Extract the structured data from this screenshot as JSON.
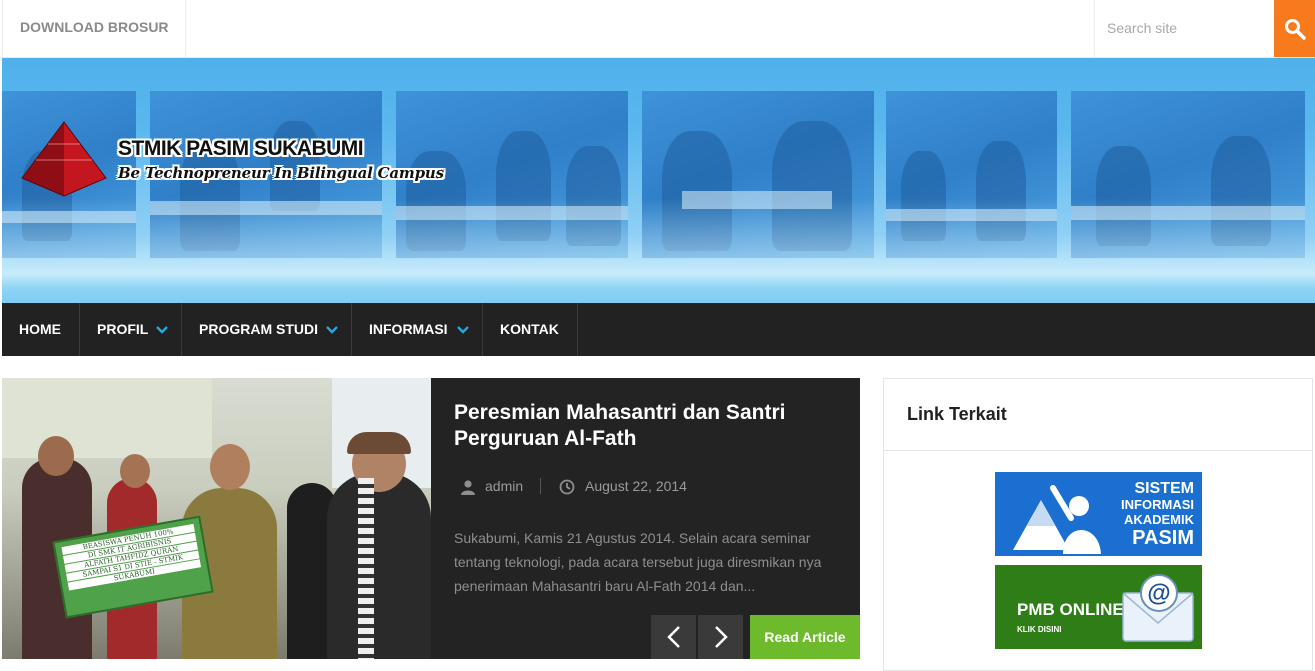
{
  "topbar": {
    "download_label": "DOWNLOAD BROSUR",
    "search_placeholder": "Search site",
    "search_icon": "search-icon"
  },
  "header": {
    "site_title": "STMIK PASIM SUKABUMI",
    "tagline": "Be Technopreneur In Bilingual Campus",
    "colors": {
      "banner_blue": "#4fb0ea",
      "logo_red": "#b3121a"
    }
  },
  "nav": {
    "items": [
      {
        "label": "HOME",
        "dropdown": false
      },
      {
        "label": "PROFIL",
        "dropdown": true
      },
      {
        "label": "PROGRAM STUDI",
        "dropdown": true
      },
      {
        "label": "INFORMASI",
        "dropdown": true
      },
      {
        "label": "KONTAK",
        "dropdown": false
      }
    ],
    "caret_color": "#29a8e0"
  },
  "featured": {
    "title": "Peresmian Mahasantri dan Santri Perguruan Al-Fath",
    "author": "admin",
    "date": "August 22, 2014",
    "excerpt": "Sukabumi, Kamis 21 Agustus 2014. Selain acara seminar tentang teknologi, pada acara tersebut juga diresmikan nya penerimaan Mahasantri baru Al-Fath 2014 dan...",
    "read_more": "Read Article",
    "photo_board": [
      "BEASISWA PENUH 100%",
      "DI SMK IT AGRIBISNIS",
      "ALFATH TAHFIDZ QURAN",
      "SAMPAI S1 DI STIE - STMIK",
      "SUKABUMI"
    ],
    "accent_color": "#6dbb2d"
  },
  "sidebar": {
    "widget_title": "Link Terkait",
    "sia_banner": [
      "SISTEM",
      "INFORMASI",
      "AKADEMIK",
      "PASIM"
    ],
    "pmb_banner": {
      "title": "PMB ONLINE",
      "subtitle": "KLIK DISINI"
    }
  }
}
